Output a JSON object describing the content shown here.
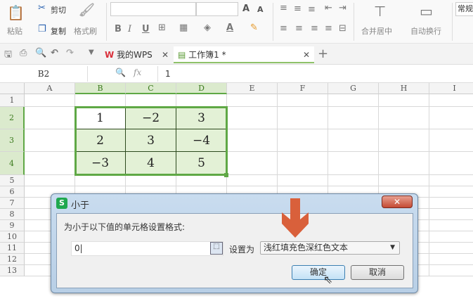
{
  "ribbon": {
    "paste": "粘贴",
    "cut": "剪切",
    "copy": "复制",
    "format_painter": "格式刷",
    "bold": "B",
    "italic": "I",
    "underline": "U",
    "merge_center": "合并居中",
    "wrap_text": "自动换行",
    "number_format": "常规",
    "grow_font": "A",
    "shrink_font": "A",
    "font_color": "A"
  },
  "tabs": [
    {
      "label": "我的WPS",
      "icon": "wps-logo-icon"
    },
    {
      "label": "工作簿1 *",
      "icon": "sheet-icon",
      "active": true
    }
  ],
  "formula_bar": {
    "name_box": "B2",
    "fx": "fx",
    "value": "1"
  },
  "columns": [
    "A",
    "B",
    "C",
    "D",
    "E",
    "F",
    "G",
    "H",
    "I"
  ],
  "rows": [
    "1",
    "2",
    "3",
    "4",
    "5",
    "6",
    "7",
    "8",
    "9",
    "10",
    "11",
    "12",
    "13"
  ],
  "cells": [
    [
      "1",
      "−2",
      "3"
    ],
    [
      "2",
      "3",
      "−4"
    ],
    [
      "−3",
      "4",
      "5"
    ]
  ],
  "colors": {
    "selection": "#5fa845",
    "fill": "#e3f1d6",
    "arrow": "#d9603b"
  },
  "dialog": {
    "title": "小于",
    "prompt": "为小于以下值的单元格设置格式:",
    "value": "0",
    "set_as": "设置为",
    "format_option": "浅红填充色深红色文本",
    "ok": "确定",
    "cancel": "取消",
    "close": "✕"
  }
}
